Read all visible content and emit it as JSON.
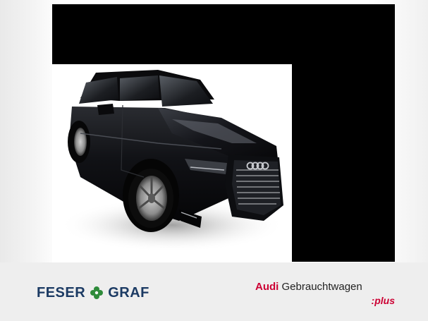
{
  "dealer": {
    "name_left": "FESER",
    "name_right": "GRAF",
    "separator_icon": "clover-icon",
    "color": "#1b3a63",
    "accent_color": "#2e8b3a"
  },
  "brand_program": {
    "brand": "Audi",
    "label": "Gebrauchtwagen",
    "suffix": ":plus",
    "brand_color": "#cc0033"
  },
  "photo": {
    "subject": "car-photo"
  }
}
